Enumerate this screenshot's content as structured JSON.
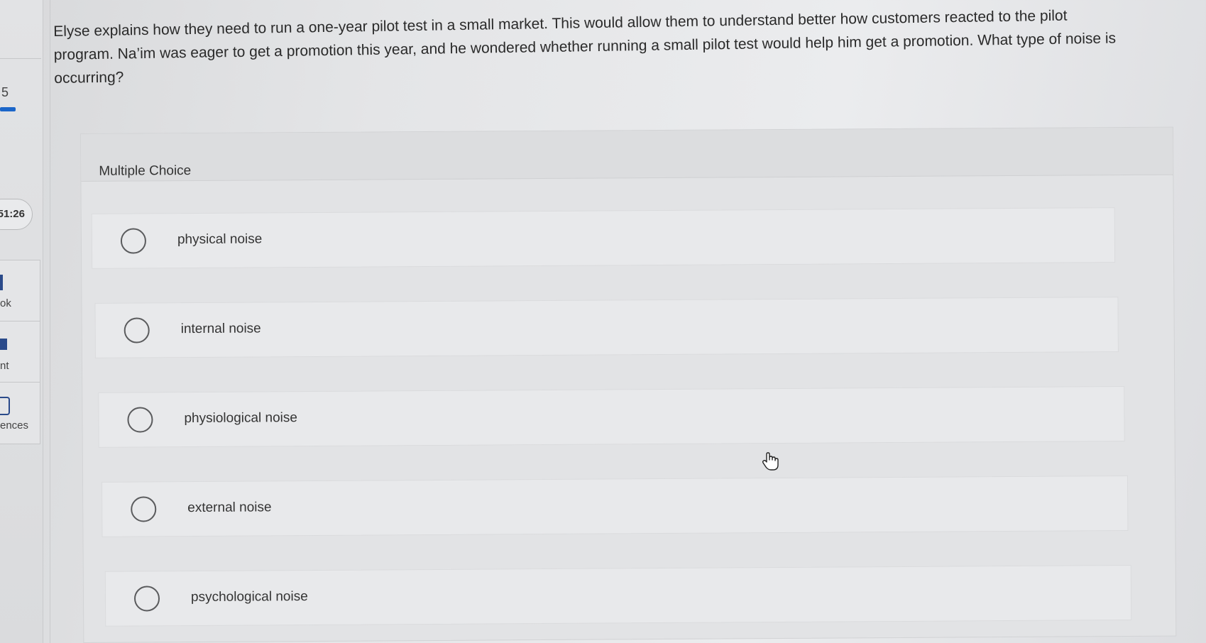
{
  "sidebar": {
    "question_number": "5",
    "timer": "51:26",
    "items": [
      {
        "label": "ok"
      },
      {
        "label": "nt"
      },
      {
        "label": "ences"
      }
    ]
  },
  "question": {
    "text": "Elyse explains how they need to run a one-year pilot test in a small market. This would allow them to understand better how customers reacted to the pilot program. Na’im was eager to get a promotion this year, and he wondered whether running a small pilot test would help him get a promotion. What type of noise is occurring?"
  },
  "mc": {
    "title": "Multiple Choice",
    "options": [
      {
        "label": "physical noise"
      },
      {
        "label": "internal noise"
      },
      {
        "label": "physiological noise"
      },
      {
        "label": "external noise"
      },
      {
        "label": "psychological noise"
      }
    ]
  },
  "icons": {
    "cursor": "hand-pointer-icon"
  },
  "colors": {
    "accent": "#1b66c9"
  }
}
